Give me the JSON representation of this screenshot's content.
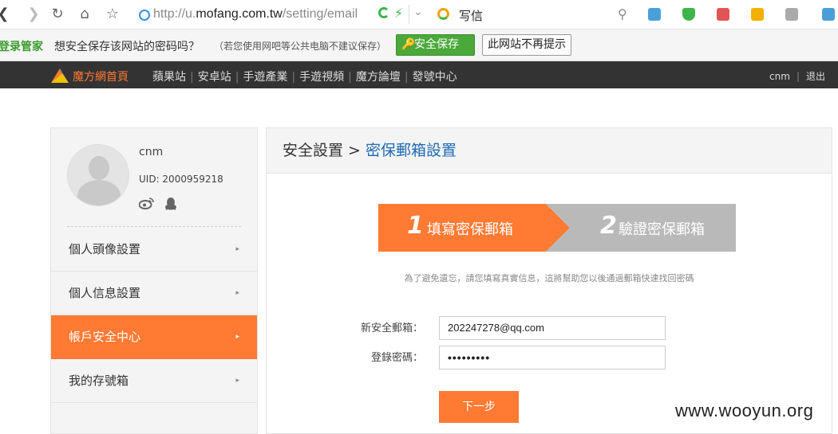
{
  "browser": {
    "url_prefix": "http://u.",
    "url_domain": "mofang.com.tw",
    "url_path": "/setting/email",
    "search_label": "写信"
  },
  "password_bar": {
    "brand": "登录管家",
    "question": "想安全保存该网站的密码吗？",
    "note": "（若您使用网吧等公共电脑不建议保存）",
    "save_label": "安全保存",
    "never_label": "此网站不再提示"
  },
  "site_nav": {
    "home": "魔方網首頁",
    "items": [
      "蘋果站",
      "安卓站",
      "手遊產業",
      "手遊視頻",
      "魔方論壇",
      "發號中心"
    ],
    "user": "cnm",
    "logout": "退出"
  },
  "sidebar": {
    "name": "cnm",
    "uid": "UID: 2000959218",
    "menu": [
      {
        "label": "個人頭像設置",
        "active": false
      },
      {
        "label": "個人信息設置",
        "active": false
      },
      {
        "label": "帳戶安全中心",
        "active": true
      },
      {
        "label": "我的存號箱",
        "active": false
      }
    ]
  },
  "main": {
    "crumb_root": "安全設置",
    "crumb_sep": ">",
    "crumb_current": "密保郵箱設置",
    "steps": [
      {
        "num": "1",
        "label": "填寫密保郵箱"
      },
      {
        "num": "2",
        "label": "驗證密保郵箱"
      }
    ],
    "hint": "為了避免遺忘，請您填寫真實信息，這將幫助您以後通過郵箱快速找回密碼",
    "email_label": "新安全郵箱：",
    "email_value": "202247278@qq.com",
    "password_label": "登錄密碼：",
    "password_value": "•••••••••",
    "next_label": "下一步"
  },
  "watermark": "www.wooyun.org",
  "colors": {
    "accent": "#ff7a33",
    "link": "#1e6ab3",
    "nav_bg": "#333333",
    "save_green": "#4ba83b"
  }
}
